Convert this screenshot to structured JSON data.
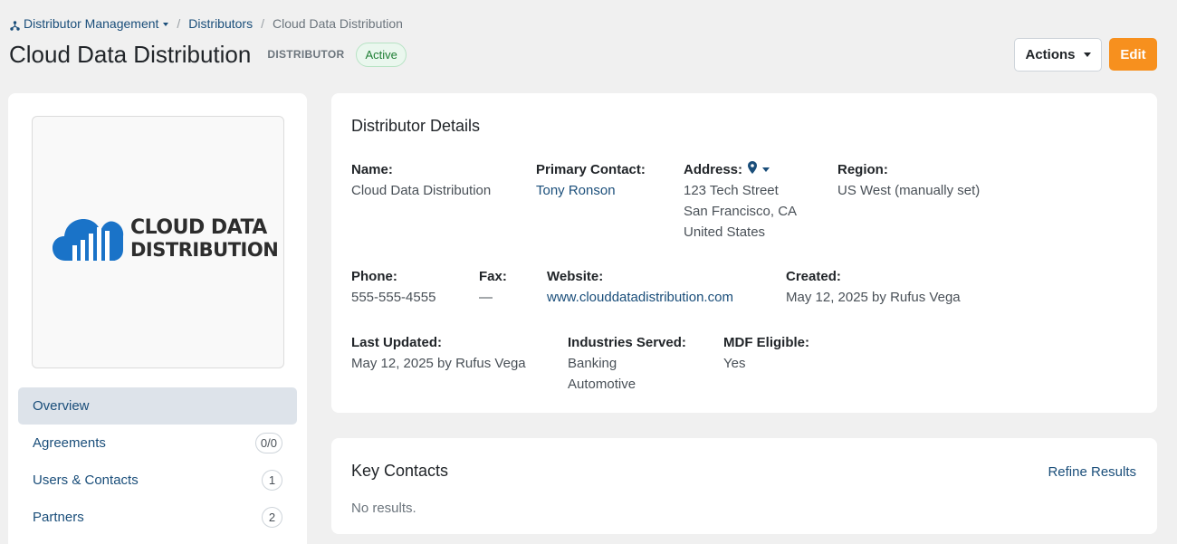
{
  "breadcrumb": {
    "root": "Distributor Management",
    "parent": "Distributors",
    "current": "Cloud Data Distribution"
  },
  "header": {
    "title": "Cloud Data Distribution",
    "type_label": "DISTRIBUTOR",
    "status": "Active",
    "actions_label": "Actions",
    "edit_label": "Edit"
  },
  "logo": {
    "line1": "CLOUD DATA",
    "line2": "DISTRIBUTION",
    "brand_color": "#1a73c8"
  },
  "nav": {
    "items": [
      {
        "label": "Overview",
        "badge": null,
        "active": true
      },
      {
        "label": "Agreements",
        "badge": "0/0"
      },
      {
        "label": "Users & Contacts",
        "badge": "1"
      },
      {
        "label": "Partners",
        "badge": "2"
      }
    ]
  },
  "details": {
    "title": "Distributor Details",
    "name_label": "Name:",
    "name_value": "Cloud Data Distribution",
    "primary_contact_label": "Primary Contact:",
    "primary_contact_value": "Tony Ronson",
    "address_label": "Address:",
    "address_line1": "123 Tech Street",
    "address_line2": "San Francisco, CA",
    "address_line3": "United States",
    "region_label": "Region:",
    "region_value": "US West (manually set)",
    "phone_label": "Phone:",
    "phone_value": "555-555-4555",
    "fax_label": "Fax:",
    "fax_value": "—",
    "website_label": "Website:",
    "website_value": "www.clouddatadistribution.com",
    "created_label": "Created:",
    "created_value": "May 12, 2025 by Rufus Vega",
    "updated_label": "Last Updated:",
    "updated_value": "May 12, 2025 by Rufus Vega",
    "industries_label": "Industries Served:",
    "industry1": "Banking",
    "industry2": "Automotive",
    "mdf_label": "MDF Eligible:",
    "mdf_value": "Yes"
  },
  "contacts": {
    "title": "Key Contacts",
    "refine_label": "Refine Results",
    "empty_text": "No results."
  },
  "colors": {
    "link": "#1a4e7a",
    "accent": "#f7901e",
    "status_green": "#1e7e34"
  }
}
